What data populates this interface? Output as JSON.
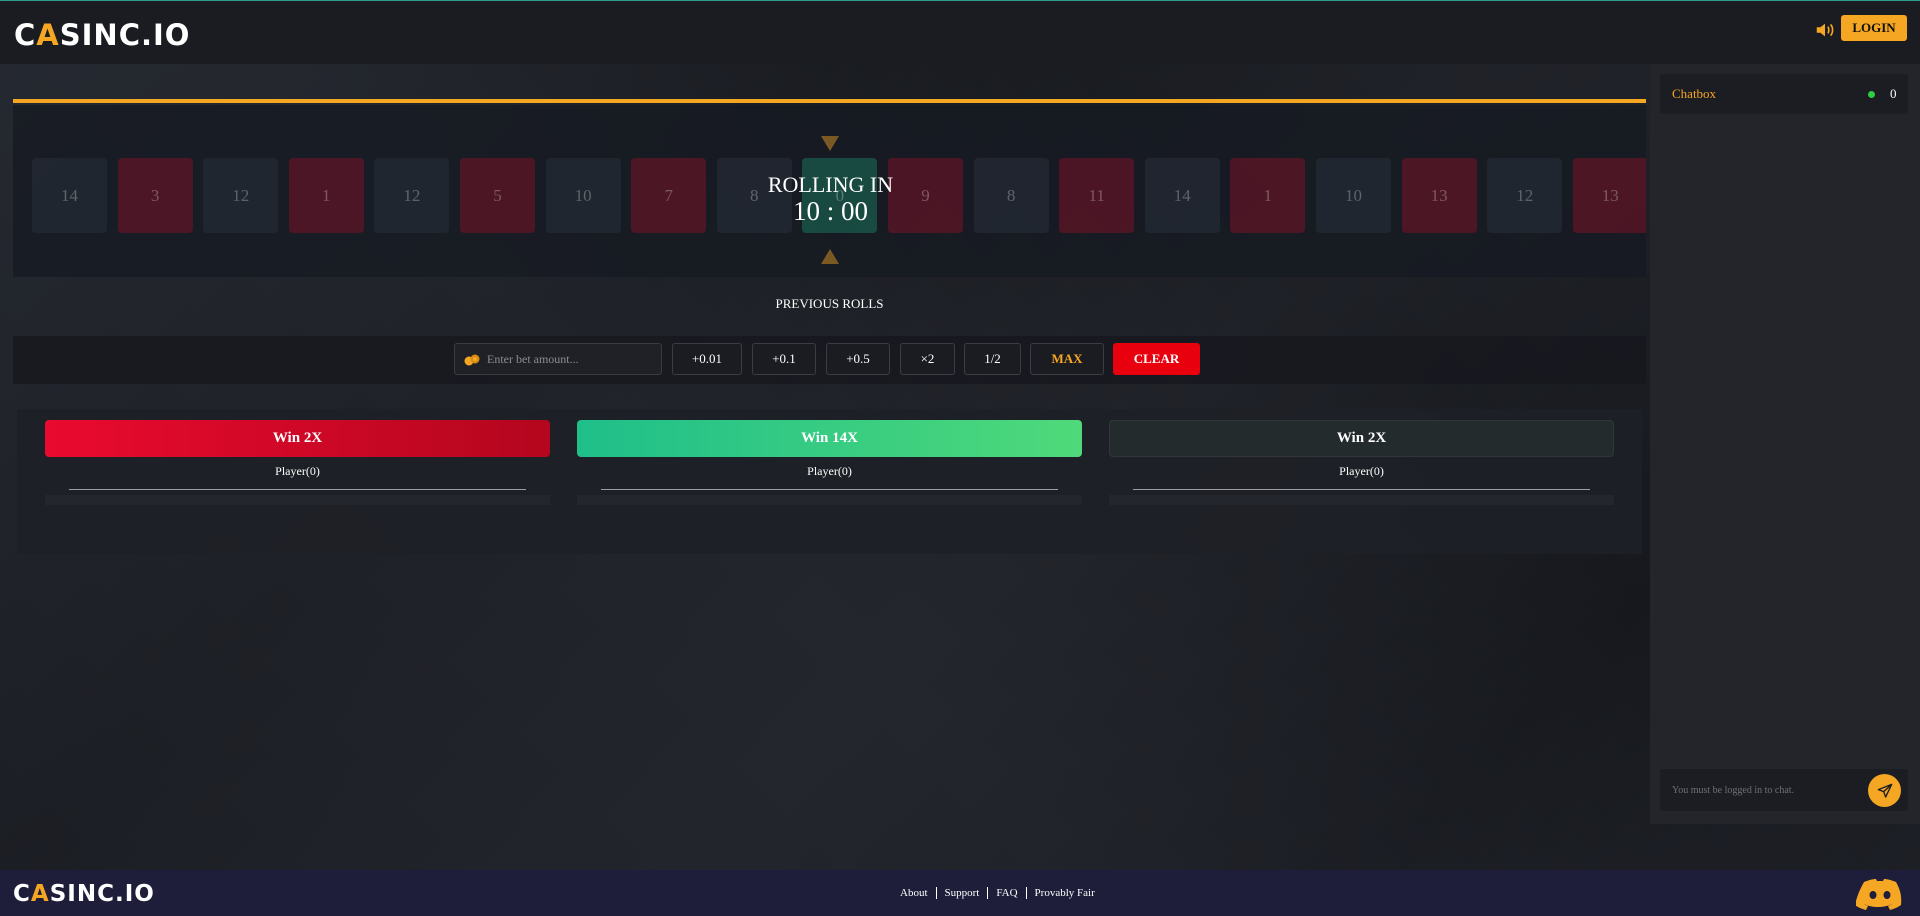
{
  "header": {
    "logo_pre": "C",
    "logo_accent": "A",
    "logo_post": "SINC.IO",
    "login_label": "LOGIN",
    "icons": {
      "sound": "speaker-icon"
    }
  },
  "roulette": {
    "tiles": [
      {
        "n": "14",
        "c": "dark"
      },
      {
        "n": "3",
        "c": "red"
      },
      {
        "n": "12",
        "c": "dark"
      },
      {
        "n": "1",
        "c": "red"
      },
      {
        "n": "12",
        "c": "dark"
      },
      {
        "n": "5",
        "c": "red"
      },
      {
        "n": "10",
        "c": "dark"
      },
      {
        "n": "7",
        "c": "red"
      },
      {
        "n": "8",
        "c": "dark"
      },
      {
        "n": "0",
        "c": "green"
      },
      {
        "n": "9",
        "c": "red"
      },
      {
        "n": "8",
        "c": "dark"
      },
      {
        "n": "11",
        "c": "red"
      },
      {
        "n": "14",
        "c": "dark"
      },
      {
        "n": "1",
        "c": "red"
      },
      {
        "n": "10",
        "c": "dark"
      },
      {
        "n": "13",
        "c": "red"
      },
      {
        "n": "12",
        "c": "dark"
      },
      {
        "n": "13",
        "c": "red"
      }
    ],
    "status_label": "ROLLING IN",
    "timer": "10 : 00",
    "previous_rolls_label": "PREVIOUS ROLLS"
  },
  "bet": {
    "placeholder": "Enter bet amount...",
    "chips": [
      "+0.01",
      "+0.1",
      "+0.5",
      "×2",
      "1/2"
    ],
    "max_label": "MAX",
    "clear_label": "CLEAR"
  },
  "columns": [
    {
      "label": "Win 2X",
      "players": "Player(0)",
      "style": "red"
    },
    {
      "label": "Win 14X",
      "players": "Player(0)",
      "style": "green"
    },
    {
      "label": "Win 2X",
      "players": "Player(0)",
      "style": "dark"
    }
  ],
  "chat": {
    "title": "Chatbox",
    "online_count": "0",
    "placeholder": "You must be logged in to chat."
  },
  "footer": {
    "logo_pre": "C",
    "logo_accent": "A",
    "logo_post": "SINC.IO",
    "links": [
      "About",
      "Support",
      "FAQ",
      "Provably Fair"
    ]
  },
  "colors": {
    "accent": "#f5a623",
    "red": "#e8000f",
    "green": "#2ecc71"
  }
}
